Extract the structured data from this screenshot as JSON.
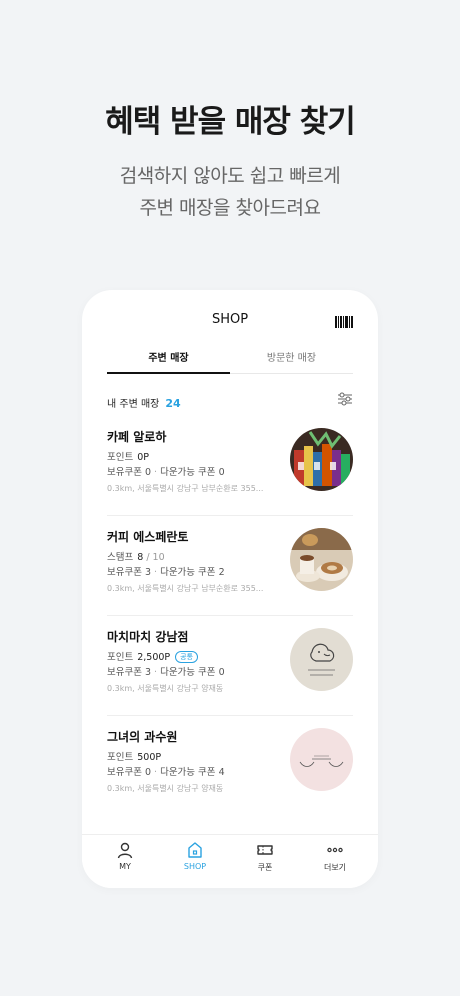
{
  "headline": "혜택 받을 매장 찾기",
  "subline": [
    "검색하지 않아도 쉽고 빠르게",
    "주변 매장을 찾아드려요"
  ],
  "app": {
    "title": "SHOP",
    "tabs": [
      {
        "label": "주변 매장",
        "active": true
      },
      {
        "label": "방문한 매장",
        "active": false
      }
    ],
    "nearby_label": "내 주변 매장",
    "nearby_count": "24",
    "stores": [
      {
        "name": "카페 알로하",
        "kind": "포인트",
        "value": "0P",
        "total": "",
        "badge": "",
        "coupon_label": "보유쿠폰",
        "coupon_count": "0",
        "download_label": "다운가능 쿠폰",
        "download_count": "0",
        "address": "0.3km, 서울특별시 강남구 남부순환로 355..."
      },
      {
        "name": "커피 에스페란토",
        "kind": "스탬프",
        "value": "8",
        "total": "/ 10",
        "badge": "",
        "coupon_label": "보유쿠폰",
        "coupon_count": "3",
        "download_label": "다운가능 쿠폰",
        "download_count": "2",
        "address": "0.3km, 서울특별시 강남구 남부순환로 355..."
      },
      {
        "name": "마치마치 강남점",
        "kind": "포인트",
        "value": "2,500P",
        "total": "",
        "badge": "공통",
        "coupon_label": "보유쿠폰",
        "coupon_count": "3",
        "download_label": "다운가능 쿠폰",
        "download_count": "0",
        "address": "0.3km, 서울특별시 강남구 양재동"
      },
      {
        "name": "그녀의 과수원",
        "kind": "포인트",
        "value": "500P",
        "total": "",
        "badge": "",
        "coupon_label": "보유쿠폰",
        "coupon_count": "0",
        "download_label": "다운가능 쿠폰",
        "download_count": "4",
        "address": "0.3km, 서울특별시 강남구 양재동"
      }
    ],
    "tabbar": [
      {
        "label": "MY",
        "icon": "person-icon",
        "active": false
      },
      {
        "label": "SHOP",
        "icon": "shop-icon",
        "active": true
      },
      {
        "label": "쿠폰",
        "icon": "ticket-icon",
        "active": false
      },
      {
        "label": "더보기",
        "icon": "more-icon",
        "active": false
      }
    ]
  },
  "colors": {
    "accent": "#2aa2e0",
    "background": "#f2f4f6"
  }
}
